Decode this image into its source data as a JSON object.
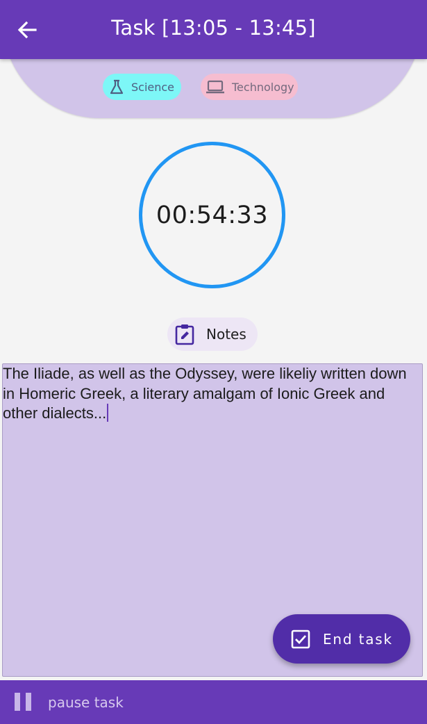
{
  "appbar": {
    "title": "Task [13:05 - 13:45]",
    "back_icon": "arrow-back-icon"
  },
  "tags": [
    {
      "label": "Science",
      "icon": "flask-icon",
      "color": "#7df7f7"
    },
    {
      "label": "Technology",
      "icon": "laptop-icon",
      "color": "#f6bdd0"
    }
  ],
  "timer": {
    "value": "00:54:33",
    "ring_color": "#2196f3"
  },
  "notes": {
    "button_label": "Notes",
    "icon": "edit-clipboard-icon",
    "text": "The Iliade, as well as the Odyssey, were likeliy written down in Homeric Greek, a literary amalgam of Ionic Greek and other dialects..."
  },
  "fab": {
    "label": "End task",
    "icon": "checkbox-icon"
  },
  "bottom_bar": {
    "label": "pause task",
    "icon": "pause-icon"
  },
  "colors": {
    "primary": "#673ab7",
    "card": "#d1c4e9",
    "fab": "#512da8"
  }
}
